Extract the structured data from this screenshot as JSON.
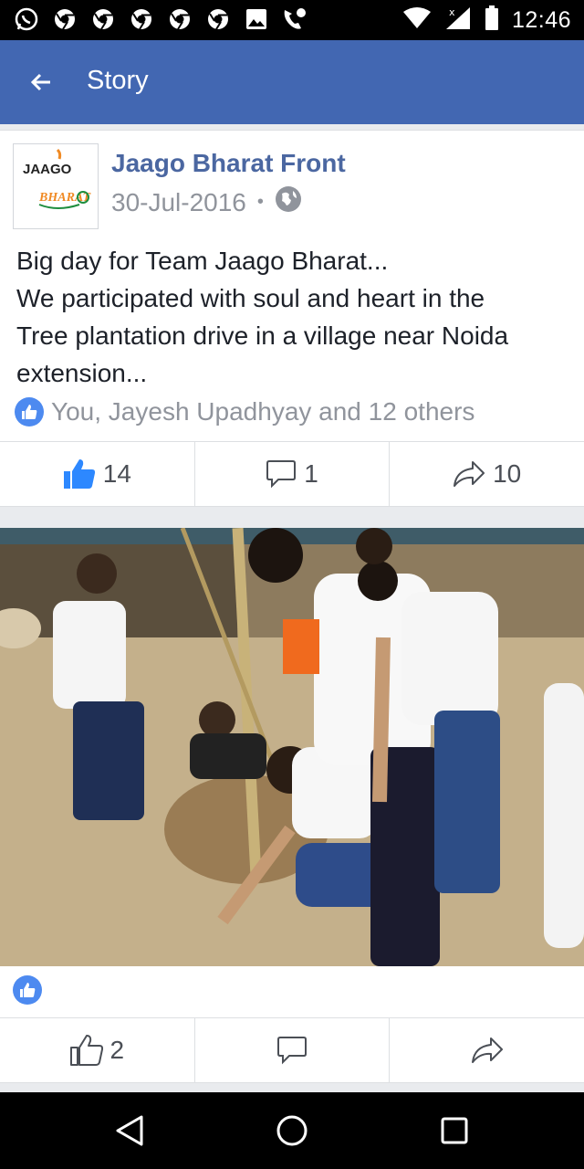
{
  "status_bar": {
    "time": "12:46",
    "left_icons": [
      "whatsapp-icon",
      "chrome-icon",
      "chrome-icon",
      "chrome-icon",
      "chrome-icon",
      "chrome-icon",
      "image-icon",
      "missed-call-icon"
    ],
    "right_icons": [
      "wifi-icon",
      "signal-icon",
      "battery-icon"
    ]
  },
  "app_bar": {
    "title": "Story"
  },
  "post": {
    "author": "Jaago Bharat Front",
    "date": "30-Jul-2016",
    "separator": "•",
    "avatar_text": {
      "line1": "JAAGO",
      "line2": "BHARAT"
    },
    "text_lines": [
      "Big day for Team Jaago Bharat...",
      "We participated with soul and heart in the",
      "Tree plantation drive in a village near Noida",
      "extension..."
    ],
    "reactions_text": "You, Jayesh Upadhyay and 12 others",
    "actions": {
      "likes": "14",
      "comments": "1",
      "shares": "10"
    }
  },
  "photo": {
    "actions": {
      "likes": "2"
    }
  },
  "colors": {
    "brand": "#4267b2",
    "link": "#4b67a1",
    "muted": "#90949c",
    "like": "#4d8af0"
  }
}
